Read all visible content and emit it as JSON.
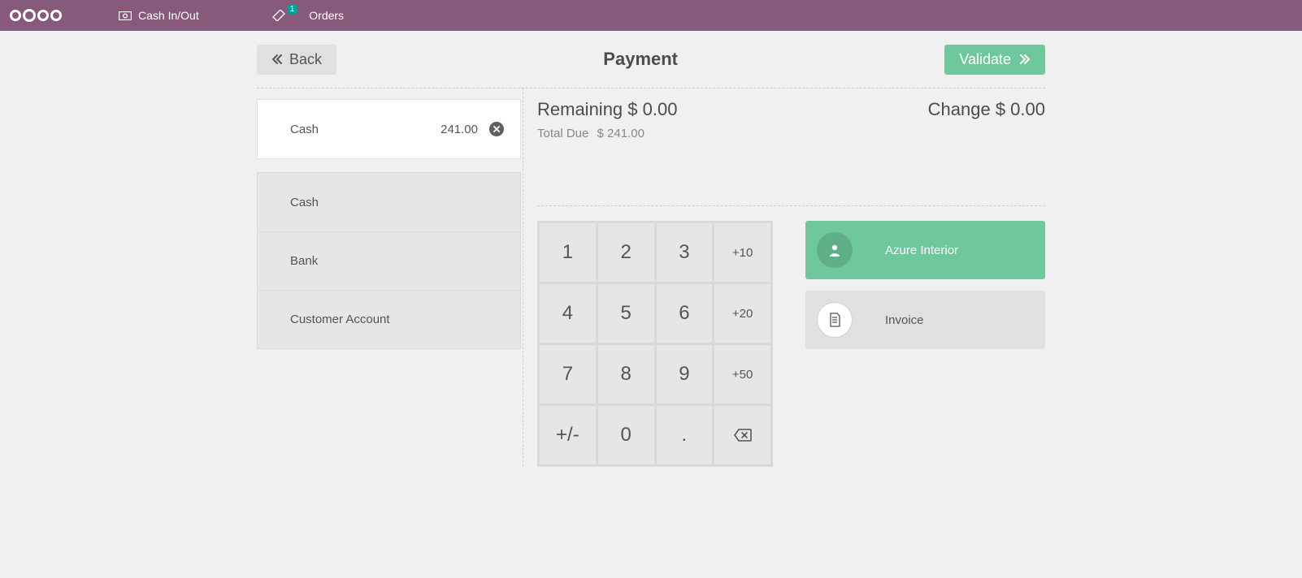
{
  "topbar": {
    "cash_in_out": "Cash In/Out",
    "orders": "Orders",
    "orders_count": "1"
  },
  "header": {
    "back_label": "Back",
    "title": "Payment",
    "validate_label": "Validate"
  },
  "paymentline": {
    "method": "Cash",
    "amount": "241.00"
  },
  "methods": {
    "cash": "Cash",
    "bank": "Bank",
    "customer_account": "Customer Account"
  },
  "summary": {
    "remaining_label": "Remaining",
    "remaining_value": "$ 0.00",
    "change_label": "Change",
    "change_value": "$ 0.00",
    "total_due_label": "Total Due",
    "total_due_value": "$ 241.00"
  },
  "numpad": {
    "k1": "1",
    "k2": "2",
    "k3": "3",
    "p10": "+10",
    "k4": "4",
    "k5": "5",
    "k6": "6",
    "p20": "+20",
    "k7": "7",
    "k8": "8",
    "k9": "9",
    "p50": "+50",
    "pm": "+/-",
    "k0": "0",
    "dot": "."
  },
  "side": {
    "customer": "Azure Interior",
    "invoice": "Invoice"
  }
}
